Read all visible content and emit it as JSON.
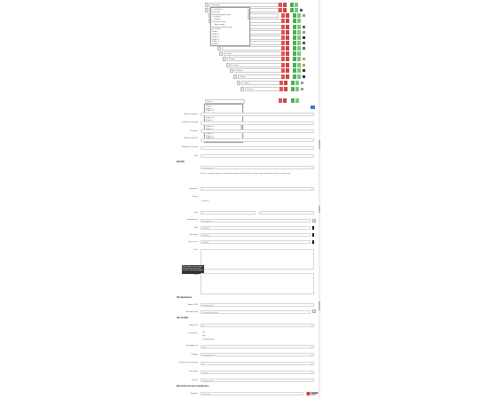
{
  "tree": {
    "rows": [
      {
        "value": "Категория"
      },
      {
        "value": ""
      },
      {
        "value": ""
      },
      {
        "value": ""
      },
      {
        "value": ""
      },
      {
        "value": ""
      },
      {
        "value": ""
      },
      {
        "value": ""
      },
      {
        "value": ""
      },
      {
        "value": "Раздел"
      },
      {
        "value": "Раздел"
      },
      {
        "value": "Раздел"
      },
      {
        "value": "Раздел"
      },
      {
        "value": "Раздел"
      },
      {
        "value": "Раздел"
      },
      {
        "value": "Раздел"
      }
    ]
  },
  "dropdown_top": {
    "items": [
      "— выберите —",
      "Категория",
      "Категория подкатегория",
      "— раздел 1",
      "— раздел 2",
      "Категория товара",
      "Подкатегория",
      "Категория товаров и услуг",
      "Категория 2",
      "Раздел",
      "Раздел 1",
      "Раздел 2",
      "Раздел 3",
      "Раздел 4",
      "Раздел 5"
    ]
  },
  "dropdown_second": {
    "placeholder": "Поиск...",
    "items": [
      "Раздел",
      "Раздел 1",
      "Раздел 1.1",
      "Раздел 1.2 подраздел",
      "Раздел 1.3",
      "Раздел 1.4",
      "Раздел 2",
      "Раздел 2.1",
      "Раздел 2.2",
      "Раздел 2.3",
      "Раздел 3",
      "Раздел 3.1",
      "Раздел 3.2",
      "Раздел 4",
      "Раздел 4.1",
      "Раздел 5"
    ]
  },
  "form": {
    "row1_label": "Название раздела",
    "row2_label": "Название категории",
    "row3_label": "Заголовок",
    "row4_label": "Краткое описание",
    "row5_label": "Подробное описание",
    "row6_label": "Дата",
    "section1": "Дизайн",
    "design_select": "По умолчанию",
    "note": "Шаблон страницы определяет внешний вид раздела. Если шаблон не выбран, будет использован шаблон по умолчанию.",
    "sort_label": "Сортировка",
    "sort_value": "0",
    "link_label": "Ссылка",
    "link_text": "добавить",
    "price_label": "Цена",
    "price_from": "0",
    "price_to": "0",
    "img1_label": "Изображение",
    "img1_value": "Не выбрано",
    "color1_label": "Цвет",
    "color1_value": "#000000",
    "color2_label": "Цвет фона",
    "color2_value": "#000000",
    "color3_label": "Цвет текста",
    "color3_value": "#000000",
    "text_label": "Текст",
    "tooltip": "Используйте этот блок для вывода дополнительного текста на странице раздела.",
    "meta_label": "Мета",
    "section2": "Продвижение",
    "seo_url_label": "Адрес (URL)",
    "seo_url_value": "/catalog/razdel",
    "seo_title_label": "Заголовок (title)",
    "seo_title_value": "Заголовок страницы",
    "section3": "Настройки",
    "set1_label": "Количество",
    "set1_value": "10",
    "set2_label": "Показывать",
    "radio1": "Да",
    "radio2": "Нет",
    "radio3": "По умолчанию",
    "set3_label": "Сортировать по",
    "set3_value": "Дате",
    "set4_label": "Порядок",
    "set4_value": "По возрастанию",
    "set5_label": "Количество на странице",
    "set5_value": "20",
    "set6_label": "Тип вывода",
    "set6_value": "Список",
    "set7_label": "Шаблон",
    "set7_value": "По умолчанию",
    "section4": "Дополнительные параметры",
    "set8_label": "Параметр",
    "set8_value": "Значение"
  },
  "colors": {
    "red": "#e05252",
    "green": "#4caf50",
    "blue": "#2d7fd6",
    "black": "#111111"
  }
}
